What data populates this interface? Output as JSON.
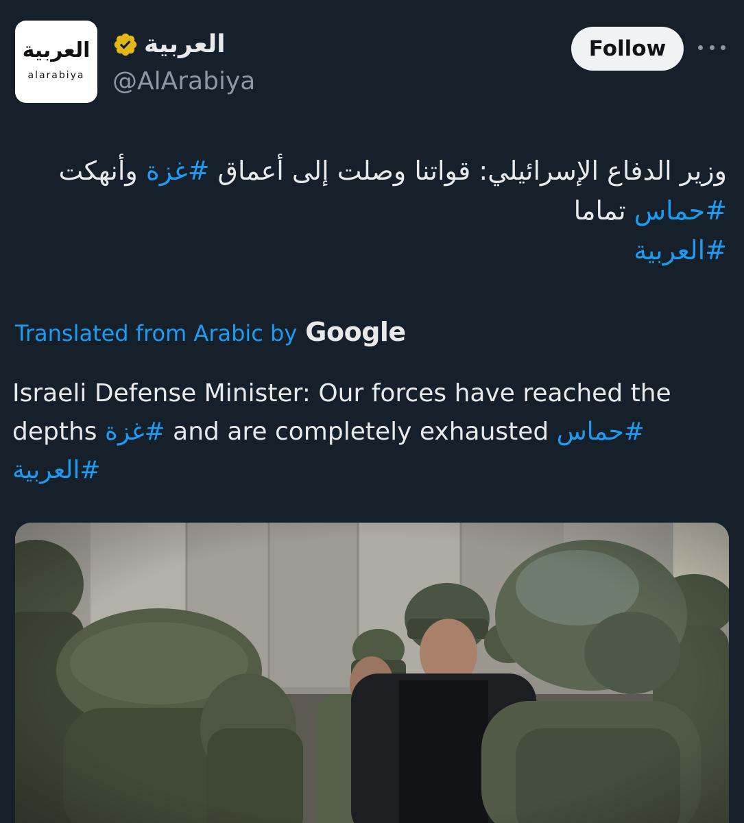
{
  "header": {
    "avatar": {
      "logo_arabic": "العربية",
      "logo_latin": "alarabiya"
    },
    "display_name": "العربية",
    "verified_icon": "verified-badge-icon",
    "handle": "@AlArabiya",
    "follow_label": "Follow",
    "more_icon": "more-options-icon"
  },
  "tweet": {
    "arabic": {
      "line1_text": "وزير الدفاع الإسرائيلي: قواتنا وصلت إلى أعماق ",
      "line1_tag": "#غزة",
      "line1_end": " وأنهكت",
      "line2_tag": "#حماس",
      "line2_text": " تماما",
      "line3_tag": "#العربية"
    },
    "translation": {
      "label": "Translated from Arabic by",
      "provider": "Google"
    },
    "english": {
      "part1": "Israeli Defense Minister: Our forces have reached the depths ",
      "tag1": "#غزة",
      "part2": " and are completely exhausted ",
      "tag2": "#حماس",
      "tag3": "#العربية"
    },
    "media": {
      "description_icon": "photo"
    }
  },
  "colors": {
    "background": "#15202b",
    "text": "#e7e9ea",
    "secondary_text": "#8b98a5",
    "link": "#1d9bf0",
    "verified_gold": "#e2b719",
    "follow_bg": "#eff3f4"
  }
}
